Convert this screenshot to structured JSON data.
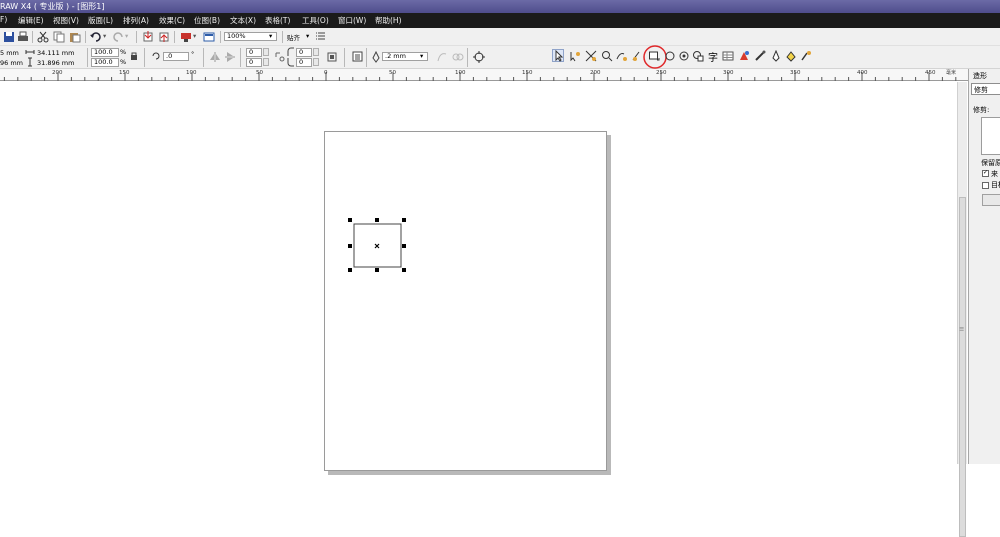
{
  "window": {
    "title": "RAW X4 ( 专业版 ) - [图形1]"
  },
  "menu": [
    {
      "label": "F)"
    },
    {
      "label": "编辑(E)"
    },
    {
      "label": "视图(V)"
    },
    {
      "label": "版面(L)"
    },
    {
      "label": "排列(A)"
    },
    {
      "label": "效果(C)"
    },
    {
      "label": "位图(B)"
    },
    {
      "label": "文本(X)"
    },
    {
      "label": "表格(T)"
    },
    {
      "label": "工具(O)"
    },
    {
      "label": "窗口(W)"
    },
    {
      "label": "帮助(H)"
    }
  ],
  "standard_toolbar": {
    "zoom_value": "100%",
    "snap_label": "贴齐"
  },
  "property_bar": {
    "x_value": "5 mm",
    "y_value": "96 mm",
    "width_value": "34.111 mm",
    "height_value": "31.896 mm",
    "scale_x": "100.0",
    "scale_y": "100.0",
    "percent": "%",
    "angle_value": ".0",
    "degree": "°",
    "corner_tl": "0",
    "corner_bl": "0",
    "corner_tr": "0",
    "corner_br": "0",
    "outline_width": ".2 mm"
  },
  "ruler": {
    "labels": [
      "200",
      "150",
      "100",
      "50",
      "0",
      "50",
      "100",
      "150",
      "200",
      "250",
      "300",
      "350",
      "400",
      "450"
    ],
    "unit_label": "毫米"
  },
  "docker": {
    "tab_title": "造形",
    "dropdown_value": "修剪",
    "section_label": "修剪:",
    "keep_label": "保留原",
    "option_1": "来",
    "option_2": "目标"
  },
  "colors": {
    "highlight_circle": "#e0282a",
    "titlebar": "#5a5896",
    "menubar": "#1b1b1b"
  }
}
